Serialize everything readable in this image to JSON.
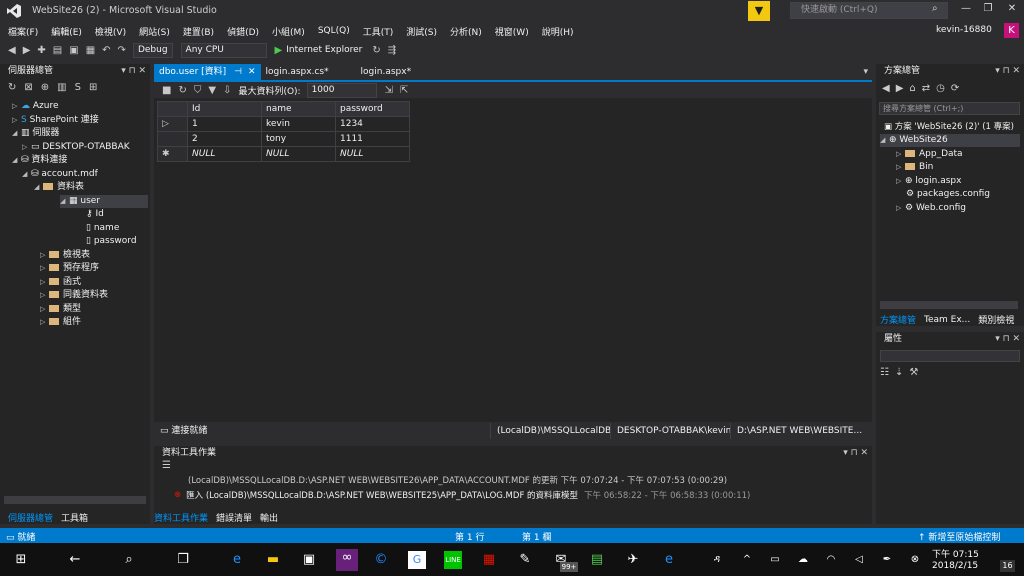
{
  "window": {
    "title": "WebSite26 (2) - Microsoft Visual Studio",
    "quick_launch_placeholder": "快速啟動 (Ctrl+Q)",
    "user": "kevin-16880",
    "avatar_letter": "K"
  },
  "menu": [
    "檔案(F)",
    "編輯(E)",
    "檢視(V)",
    "網站(S)",
    "建置(B)",
    "偵錯(D)",
    "小組(M)",
    "SQL(Q)",
    "工具(T)",
    "測試(S)",
    "分析(N)",
    "視窗(W)",
    "說明(H)"
  ],
  "toolbar": {
    "config": "Debug",
    "platform": "Any CPU",
    "run_target": "Internet Explorer"
  },
  "server_explorer": {
    "title": "伺服器總管",
    "items": [
      "Azure",
      "SharePoint 連接",
      "伺服器",
      "DESKTOP-OTABBAK",
      "資料連接",
      "account.mdf",
      "資料表",
      "user",
      "Id",
      "name",
      "password",
      "檢視表",
      "預存程序",
      "函式",
      "同義資料表",
      "類型",
      "組件"
    ]
  },
  "tabs": {
    "active": "dbo.user [資料]",
    "tab2": "login.aspx.cs*",
    "tab3": "login.aspx*"
  },
  "grid_toolbar": {
    "max_rows_label": "最大資料列(O):",
    "max_rows_value": "1000"
  },
  "grid": {
    "columns": [
      "Id",
      "name",
      "password"
    ],
    "rows": [
      {
        "marker": "▷",
        "id": "1",
        "name": "kevin",
        "password": "1234"
      },
      {
        "marker": "",
        "id": "2",
        "name": "tony",
        "password": "1111"
      },
      {
        "marker": "✱",
        "id": "NULL",
        "name": "NULL",
        "password": "NULL"
      }
    ]
  },
  "connection": {
    "status": "連接就緒",
    "instance": "(LocalDB)\\MSSQLLocalDB",
    "user": "DESKTOP-OTABBAK\\kevin",
    "path": "D:\\ASP.NET WEB\\WEBSITE..."
  },
  "data_tools": {
    "title": "資料工具作業",
    "line1": "(LocalDB)\\MSSQLLocalDB.D:\\ASP.NET WEB\\WEBSITE26\\APP_DATA\\ACCOUNT.MDF 的更新   下午 07:07:24 - 下午 07:07:53 (0:00:29)",
    "line2": "匯入 (LocalDB)\\MSSQLLocalDB.D:\\ASP.NET WEB\\WEBSITE25\\APP_DATA\\LOG.MDF 的資料庫模型",
    "line2_time": "下午 06:58:22 - 下午 06:58:33 (0:00:11)",
    "tabs": [
      "資料工具作業",
      "錯誤清單",
      "輸出"
    ],
    "left_tabs": [
      "伺服器總管",
      "工具箱"
    ]
  },
  "solution_explorer": {
    "title": "方案總管",
    "search_placeholder": "搜尋方案總管 (Ctrl+;)",
    "items": [
      "方案 'WebSite26 (2)' (1 專案)",
      "WebSite26",
      "App_Data",
      "Bin",
      "login.aspx",
      "packages.config",
      "Web.config"
    ],
    "tabs": [
      "方案總管",
      "Team Ex...",
      "類別檢視"
    ]
  },
  "properties": {
    "title": "屬性"
  },
  "status": {
    "left": "就緒",
    "line": "第 1 行",
    "col": "第 1 欄",
    "right": "新增至原始檔控制"
  },
  "taskbar": {
    "time": "下午 07:15",
    "date": "2018/2/15",
    "badge": "16",
    "mail_badge": "99+"
  }
}
